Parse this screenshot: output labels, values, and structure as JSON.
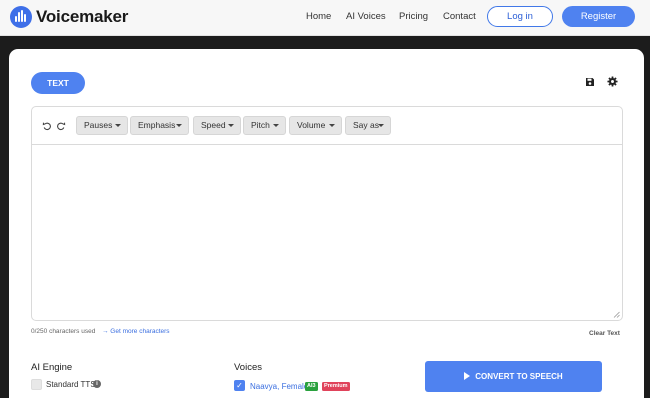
{
  "brand": {
    "name": "Voicemaker",
    "accent": "#4f82f0"
  },
  "nav": {
    "links": [
      "Home",
      "AI Voices",
      "Pricing",
      "Contact"
    ],
    "login": "Log in",
    "register": "Register"
  },
  "editor": {
    "tab": "TEXT",
    "tools": [
      "Pauses",
      "Emphasis",
      "Speed",
      "Pitch",
      "Volume",
      "Say as"
    ],
    "text": "",
    "counter": "0/250 characters used",
    "more_chars": "→ Get more characters",
    "clear": "Clear Text"
  },
  "engine": {
    "label": "AI Engine",
    "option": "Standard TTS",
    "info": "i"
  },
  "voices": {
    "label": "Voices",
    "selected": "Naavya, Female",
    "badge_ai": "AI3",
    "badge_premium": "Premium"
  },
  "convert": {
    "label": "CONVERT TO SPEECH"
  }
}
